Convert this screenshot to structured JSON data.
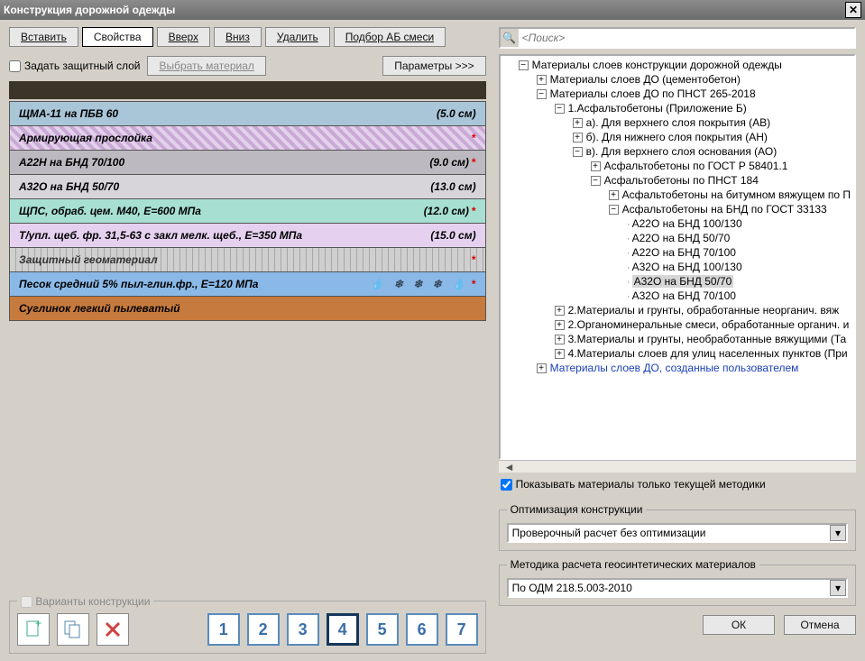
{
  "window": {
    "title": "Конструкция дорожной одежды"
  },
  "toolbar": {
    "insert": "Вставить",
    "props": "Свойства",
    "up": "Вверх",
    "down": "Вниз",
    "delete": "Удалить",
    "mix": "Подбор АБ смеси"
  },
  "row2": {
    "protective": "Задать защитный слой",
    "chooseMat": "Выбрать материал",
    "params": "Параметры >>>"
  },
  "layers": [
    {
      "name": "ЩМА-11 на ПБВ 60",
      "thk": "(5.0 см)",
      "cls": "blue",
      "star": false
    },
    {
      "name": "Армирующая прослойка",
      "thk": "",
      "cls": "hatch",
      "star": true
    },
    {
      "name": "А22Н на БНД 70/100",
      "thk": "(9.0 см)",
      "cls": "grey",
      "star": true
    },
    {
      "name": "А32О на БНД 50/70",
      "thk": "(13.0 см)",
      "cls": "lgrey",
      "star": false
    },
    {
      "name": "ЩПС, обраб. цем. М40, Е=600 МПа",
      "thk": "(12.0 см)",
      "cls": "teal",
      "star": true
    },
    {
      "name": "Т/упл. щеб. фр. 31,5-63 с закл мелк. щеб., Е=350 МПа",
      "thk": "(15.0 см)",
      "cls": "lilac",
      "star": false
    },
    {
      "name": "Защитный геоматериал",
      "thk": "",
      "cls": "stripes",
      "star": true
    },
    {
      "name": "Песок средний 5% пыл-глин.фр., Е=120 МПа",
      "thk": "",
      "cls": "iceblue",
      "star": true,
      "flakes": true
    },
    {
      "name": "Суглинок легкий пылеватый",
      "thk": "",
      "cls": "brown",
      "star": false
    }
  ],
  "variants": {
    "title": "Варианты конструкции",
    "nums": [
      "1",
      "2",
      "3",
      "4",
      "5",
      "6",
      "7"
    ],
    "selected": 4
  },
  "search": {
    "placeholder": "<Поиск>"
  },
  "tree": [
    {
      "lvl": 0,
      "exp": "-",
      "label": "Материалы слоев конструкции дорожной одежды"
    },
    {
      "lvl": 1,
      "exp": "+",
      "label": "Материалы слоев ДО (цементобетон)"
    },
    {
      "lvl": 1,
      "exp": "-",
      "label": "Материалы слоев ДО по ПНСТ 265-2018"
    },
    {
      "lvl": 2,
      "exp": "-",
      "label": "1.Асфальтобетоны (Приложение Б)"
    },
    {
      "lvl": 3,
      "exp": "+",
      "label": "а). Для верхнего слоя покрытия (АВ)"
    },
    {
      "lvl": 3,
      "exp": "+",
      "label": "б). Для нижнего слоя покрытия (АН)"
    },
    {
      "lvl": 3,
      "exp": "-",
      "label": "в). Для верхнего слоя основания (АО)"
    },
    {
      "lvl": 4,
      "exp": "+",
      "label": "Асфальтобетоны по ГОСТ Р 58401.1"
    },
    {
      "lvl": 4,
      "exp": "-",
      "label": "Асфальтобетоны по ПНСТ 184"
    },
    {
      "lvl": 5,
      "exp": "+",
      "label": "Асфальтобетоны на битумном вяжущем по П"
    },
    {
      "lvl": 5,
      "exp": "-",
      "label": "Асфальтобетоны на БНД по ГОСТ 33133"
    },
    {
      "lvl": 6,
      "exp": "",
      "label": "А22О на БНД 100/130"
    },
    {
      "lvl": 6,
      "exp": "",
      "label": "А22О на БНД 50/70"
    },
    {
      "lvl": 6,
      "exp": "",
      "label": "А22О на БНД 70/100"
    },
    {
      "lvl": 6,
      "exp": "",
      "label": "А32О на БНД 100/130"
    },
    {
      "lvl": 6,
      "exp": "",
      "label": "А32О на БНД 50/70",
      "sel": true
    },
    {
      "lvl": 6,
      "exp": "",
      "label": "А32О на БНД 70/100"
    },
    {
      "lvl": 2,
      "exp": "+",
      "label": "2.Материалы и грунты, обработанные неорганич. вяж"
    },
    {
      "lvl": 2,
      "exp": "+",
      "label": "2.Органоминеральные смеси, обработанные органич. и"
    },
    {
      "lvl": 2,
      "exp": "+",
      "label": "3.Материалы и грунты, необработанные вяжущими (Та"
    },
    {
      "lvl": 2,
      "exp": "+",
      "label": "4.Материалы слоев для улиц населенных пунктов (При"
    },
    {
      "lvl": 1,
      "exp": "+",
      "label": "Материалы слоев ДО, созданные пользователем",
      "user": true
    }
  ],
  "chkCurrent": "Показывать материалы только текущей методики",
  "opt": {
    "title": "Оптимизация конструкции",
    "value": "Проверочный расчет без оптимизации"
  },
  "geo": {
    "title": "Методика расчета геосинтетических материалов",
    "value": "По ОДМ 218.5.003-2010"
  },
  "footer": {
    "ok": "ОК",
    "cancel": "Отмена"
  }
}
